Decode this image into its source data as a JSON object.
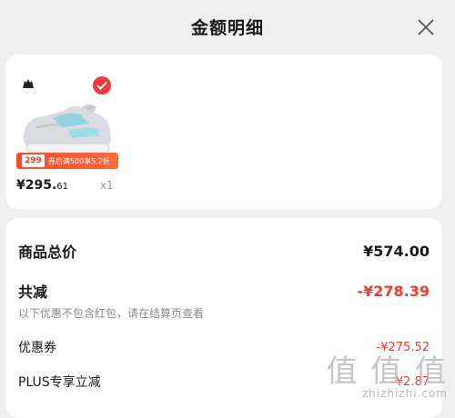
{
  "header": {
    "title": "金额明细",
    "close_icon": "close-icon"
  },
  "product": {
    "brand_icon": "adidas-logo-icon",
    "selected": true,
    "tag_amount": "299",
    "tag_promo": "券后满500享5.2折",
    "price_main": "¥295.",
    "price_decimal": "61",
    "quantity": "x1"
  },
  "summary": {
    "total_label": "商品总价",
    "total_value": "¥574.00",
    "discount_label": "共减",
    "discount_value": "-¥278.39",
    "discount_note": "以下优惠不包含红包，请在结算页查看",
    "coupon_label": "优惠券",
    "coupon_value": "-¥275.52",
    "plus_label": "PLUS专享立减",
    "plus_value": "-¥2.87"
  },
  "watermark": {
    "mark": "值 值 值",
    "site": "zhizhizhi.com"
  },
  "colors": {
    "accent": "#ef3b2f",
    "background": "#efefef",
    "card": "#ffffff"
  }
}
